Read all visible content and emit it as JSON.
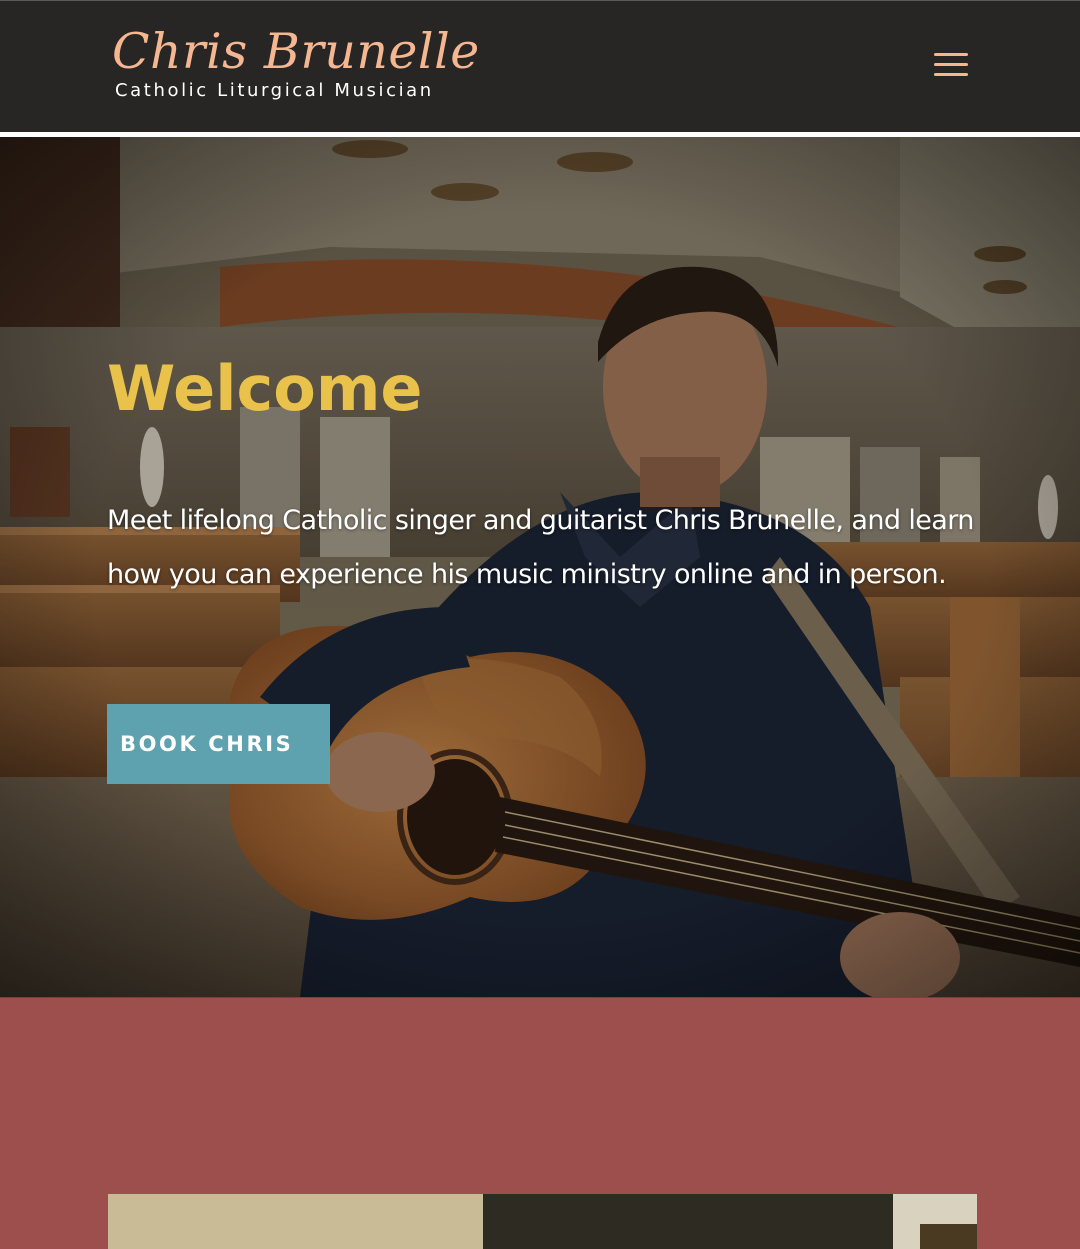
{
  "header": {
    "logo_name": "Chris Brunelle",
    "logo_tagline": "Catholic Liturgical Musician",
    "menu_icon": "hamburger-menu-icon"
  },
  "hero": {
    "title": "Welcome",
    "text": "Meet lifelong Catholic singer and guitarist Chris Brunelle, and learn how you can experience his music ministry online and in person.",
    "button_label": "BOOK CHRIS",
    "image_description_icon": "hero-background-image"
  },
  "about": {
    "image_icon": "section-photo"
  },
  "colors": {
    "header_bg": "#272625",
    "logo_accent": "#f4b791",
    "hero_title": "#e8c24a",
    "button_bg": "#5da2ae",
    "section_bg": "#9c4f4c"
  }
}
